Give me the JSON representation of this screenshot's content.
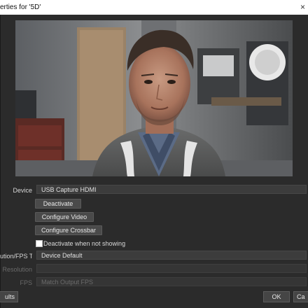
{
  "window": {
    "title": "erties for '5D'",
    "close_glyph": "×"
  },
  "form": {
    "device_label": "Device",
    "device_value": "USB Capture HDMI",
    "deactivate_label": "Deactivate",
    "configure_video_label": "Configure Video",
    "configure_crossbar_label": "Configure Crossbar",
    "deactivate_when_not_showing_label": "Deactivate when not showing",
    "resolution_fps_type_label": "ution/FPS Type",
    "resolution_fps_type_value": "Device Default",
    "resolution_label": "Resolution",
    "resolution_value": "",
    "fps_label": "FPS",
    "fps_value": "Match Output FPS"
  },
  "footer": {
    "defaults_label": "ults",
    "ok_label": "OK",
    "cancel_label": "Ca"
  }
}
